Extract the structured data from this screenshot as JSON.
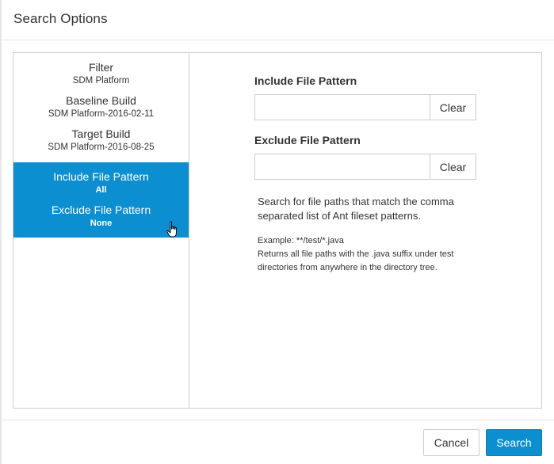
{
  "dialog": {
    "title": "Search Options"
  },
  "sidebar": {
    "items": [
      {
        "label": "Filter",
        "value": "SDM Platform"
      },
      {
        "label": "Baseline Build",
        "value": "SDM Platform-2016-02-11"
      },
      {
        "label": "Target Build",
        "value": "SDM Platform-2016-08-25"
      },
      {
        "label": "Include File Pattern",
        "value": "All"
      },
      {
        "label": "Exclude File Pattern",
        "value": "None"
      }
    ],
    "selected_color": "#0c8fd1"
  },
  "include": {
    "label": "Include File Pattern",
    "value": "",
    "clear_label": "Clear"
  },
  "exclude": {
    "label": "Exclude File Pattern",
    "value": "",
    "clear_label": "Clear"
  },
  "help": {
    "description": "Search for file paths that match the comma separated list of Ant fileset patterns.",
    "example": "Example: **/test/*.java",
    "example_desc": "Returns all file paths with the .java suffix under test directories from anywhere in the directory tree."
  },
  "footer": {
    "cancel_label": "Cancel",
    "search_label": "Search",
    "accent": "#0c8fd1"
  }
}
